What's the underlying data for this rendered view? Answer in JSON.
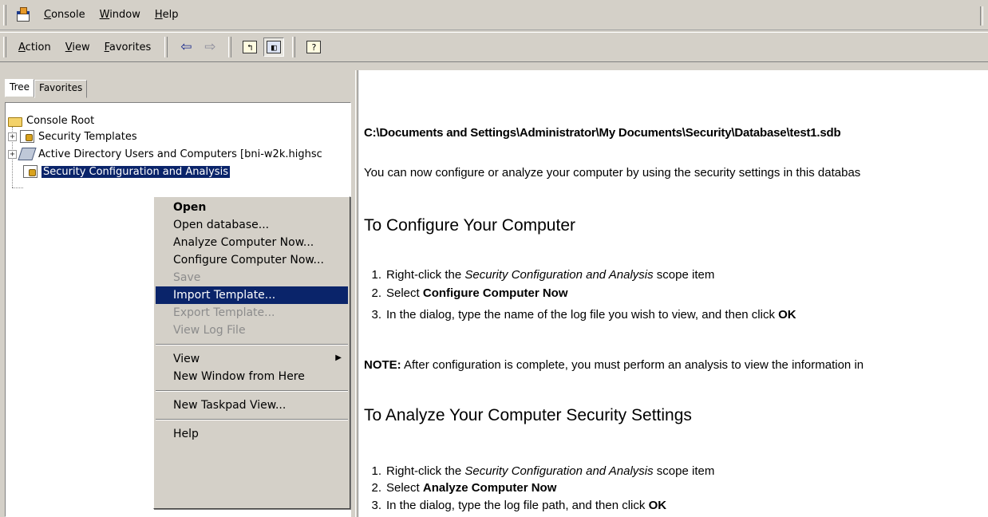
{
  "menubar": {
    "items": [
      {
        "label": "Console",
        "accel": "C"
      },
      {
        "label": "Window",
        "accel": "W"
      },
      {
        "label": "Help",
        "accel": "H"
      }
    ]
  },
  "toolbar": {
    "menus": [
      {
        "label": "Action",
        "accel": "A"
      },
      {
        "label": "View",
        "accel": "V"
      },
      {
        "label": "Favorites",
        "accel": "F"
      }
    ],
    "back_icon": "back-arrow-icon",
    "forward_icon": "forward-arrow-icon",
    "up_icon": "up-one-level-icon",
    "tree_toggle_icon": "show-hide-tree-icon",
    "help_icon": "help-icon"
  },
  "left_pane": {
    "tabs": [
      "Tree",
      "Favorites"
    ],
    "tree": {
      "root": "Console Root",
      "items": [
        {
          "label": "Security Templates",
          "icon": "security-templates-icon",
          "expandable": true
        },
        {
          "label": "Active Directory Users and Computers [bni-w2k.highsc",
          "icon": "active-directory-icon",
          "expandable": true
        },
        {
          "label": "Security Configuration and Analysis",
          "icon": "security-config-icon",
          "expandable": false,
          "selected": true
        }
      ]
    }
  },
  "context_menu": {
    "items": [
      {
        "label": "Open",
        "bold": true
      },
      {
        "label": "Open database..."
      },
      {
        "label": "Analyze Computer Now..."
      },
      {
        "label": "Configure Computer Now..."
      },
      {
        "label": "Save",
        "disabled": true
      },
      {
        "label": "Import Template...",
        "highlighted": true
      },
      {
        "label": "Export Template...",
        "disabled": true
      },
      {
        "label": "View Log File",
        "disabled": true
      },
      {
        "label": "View",
        "submenu": true
      },
      {
        "label": "New Window from Here"
      },
      {
        "label": "New Taskpad View..."
      },
      {
        "label": "Help"
      }
    ]
  },
  "right_pane": {
    "path": "C:\\Documents and Settings\\Administrator\\My Documents\\Security\\Database\\test1.sdb",
    "intro": "You can now configure or analyze your computer by using the security settings in this databas",
    "section1": {
      "heading": "To Configure Your Computer",
      "steps": [
        {
          "num": "1.",
          "pre": "Right-click the ",
          "em": "Security Configuration and Analysis",
          "post": " scope item"
        },
        {
          "num": "2.",
          "pre": "Select ",
          "strong": "Configure Computer Now",
          "post": ""
        },
        {
          "num": "3.",
          "pre": "In the dialog, type the name of the log file you wish to view, and then click ",
          "strong": "OK",
          "post": ""
        }
      ]
    },
    "note": {
      "label": "NOTE:",
      "text": " After configuration is complete, you must perform an analysis to view the information in"
    },
    "section2": {
      "heading": "To Analyze Your Computer Security Settings",
      "steps": [
        {
          "num": "1.",
          "pre": "Right-click the ",
          "em": "Security Configuration and Analysis",
          "post": " scope item"
        },
        {
          "num": "2.",
          "pre": "Select ",
          "strong": "Analyze Computer Now",
          "post": ""
        },
        {
          "num": "3.",
          "pre": "In the dialog, type the log file path, and then click ",
          "strong": "OK",
          "post": ""
        }
      ]
    }
  }
}
